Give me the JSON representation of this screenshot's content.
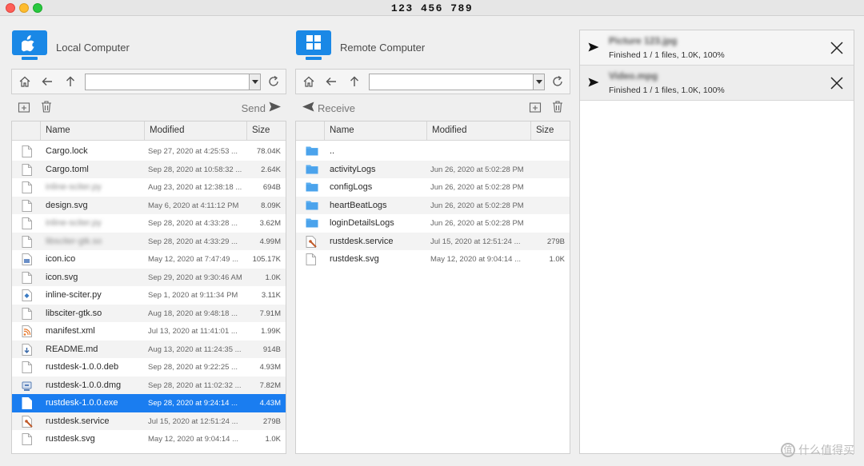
{
  "window": {
    "title": "123 456 789"
  },
  "local": {
    "title": "Local Computer",
    "path": "",
    "action_label": "Send",
    "columns": [
      "Name",
      "Modified",
      "Size"
    ],
    "files": [
      {
        "name": "Cargo.lock",
        "modified": "Sep 27, 2020 at 4:25:53 ...",
        "size": "78.04K",
        "icon": "file-icon"
      },
      {
        "name": "Cargo.toml",
        "modified": "Sep 28, 2020 at 10:58:32 ...",
        "size": "2.64K",
        "icon": "file-icon"
      },
      {
        "name": "inline-sciter.py",
        "modified": "Aug 23, 2020 at 12:38:18 ...",
        "size": "694B",
        "icon": "file-icon",
        "blurred": true
      },
      {
        "name": "design.svg",
        "modified": "May 6, 2020 at 4:11:12 PM",
        "size": "8.09K",
        "icon": "file-icon"
      },
      {
        "name": "inline-sciter.py",
        "modified": "Sep 28, 2020 at 4:33:28 ...",
        "size": "3.62M",
        "icon": "file-icon",
        "blurred": true
      },
      {
        "name": "libsciter-gtk.so",
        "modified": "Sep 28, 2020 at 4:33:29 ...",
        "size": "4.99M",
        "icon": "file-icon",
        "blurred": true
      },
      {
        "name": "icon.ico",
        "modified": "May 12, 2020 at 7:47:49 ...",
        "size": "105.17K",
        "icon": "image-file-icon"
      },
      {
        "name": "icon.svg",
        "modified": "Sep 29, 2020 at 9:30:46 AM",
        "size": "1.0K",
        "icon": "file-icon"
      },
      {
        "name": "inline-sciter.py",
        "modified": "Sep 1, 2020 at 9:11:34 PM",
        "size": "3.11K",
        "icon": "python-file-icon"
      },
      {
        "name": "libsciter-gtk.so",
        "modified": "Aug 18, 2020 at 9:48:18 ...",
        "size": "7.91M",
        "icon": "file-icon"
      },
      {
        "name": "manifest.xml",
        "modified": "Jul 13, 2020 at 11:41:01 ...",
        "size": "1.99K",
        "icon": "rss-file-icon"
      },
      {
        "name": "README.md",
        "modified": "Aug 13, 2020 at 11:24:35 ...",
        "size": "914B",
        "icon": "markdown-file-icon"
      },
      {
        "name": "rustdesk-1.0.0.deb",
        "modified": "Sep 28, 2020 at 9:22:25 ...",
        "size": "4.93M",
        "icon": "file-icon"
      },
      {
        "name": "rustdesk-1.0.0.dmg",
        "modified": "Sep 28, 2020 at 11:02:32 ...",
        "size": "7.82M",
        "icon": "disk-image-icon"
      },
      {
        "name": "rustdesk-1.0.0.exe",
        "modified": "Sep 28, 2020 at 9:24:14 ...",
        "size": "4.43M",
        "icon": "file-icon",
        "selected": true
      },
      {
        "name": "rustdesk.service",
        "modified": "Jul 15, 2020 at 12:51:24 ...",
        "size": "279B",
        "icon": "service-file-icon"
      },
      {
        "name": "rustdesk.svg",
        "modified": "May 12, 2020 at 9:04:14 ...",
        "size": "1.0K",
        "icon": "file-icon"
      }
    ]
  },
  "remote": {
    "title": "Remote Computer",
    "path": "",
    "action_label": "Receive",
    "columns": [
      "Name",
      "Modified",
      "Size"
    ],
    "files": [
      {
        "name": "..",
        "modified": "",
        "size": "",
        "icon": "folder-icon"
      },
      {
        "name": "activityLogs",
        "modified": "Jun 26, 2020 at 5:02:28 PM",
        "size": "",
        "icon": "folder-icon"
      },
      {
        "name": "configLogs",
        "modified": "Jun 26, 2020 at 5:02:28 PM",
        "size": "",
        "icon": "folder-icon"
      },
      {
        "name": "heartBeatLogs",
        "modified": "Jun 26, 2020 at 5:02:28 PM",
        "size": "",
        "icon": "folder-icon"
      },
      {
        "name": "loginDetailsLogs",
        "modified": "Jun 26, 2020 at 5:02:28 PM",
        "size": "",
        "icon": "folder-icon"
      },
      {
        "name": "rustdesk.service",
        "modified": "Jul 15, 2020 at 12:51:24 ...",
        "size": "279B",
        "icon": "service-file-icon"
      },
      {
        "name": "rustdesk.svg",
        "modified": "May 12, 2020 at 9:04:14 ...",
        "size": "1.0K",
        "icon": "file-icon"
      }
    ]
  },
  "transfers": [
    {
      "name": "Picture 123.jpg",
      "status": "Finished 1 / 1 files, 1.0K, 100%",
      "progress": 1.0
    },
    {
      "name": "Video.mpg",
      "status": "Finished 1 / 1 files, 1.0K, 100%",
      "progress": 1.0
    }
  ],
  "watermark": {
    "glyph": "值",
    "text": "什么值得买"
  },
  "colors": {
    "accent": "#1a7df0",
    "os_icon": "#1a88e6",
    "folder": "#5aaef0"
  }
}
